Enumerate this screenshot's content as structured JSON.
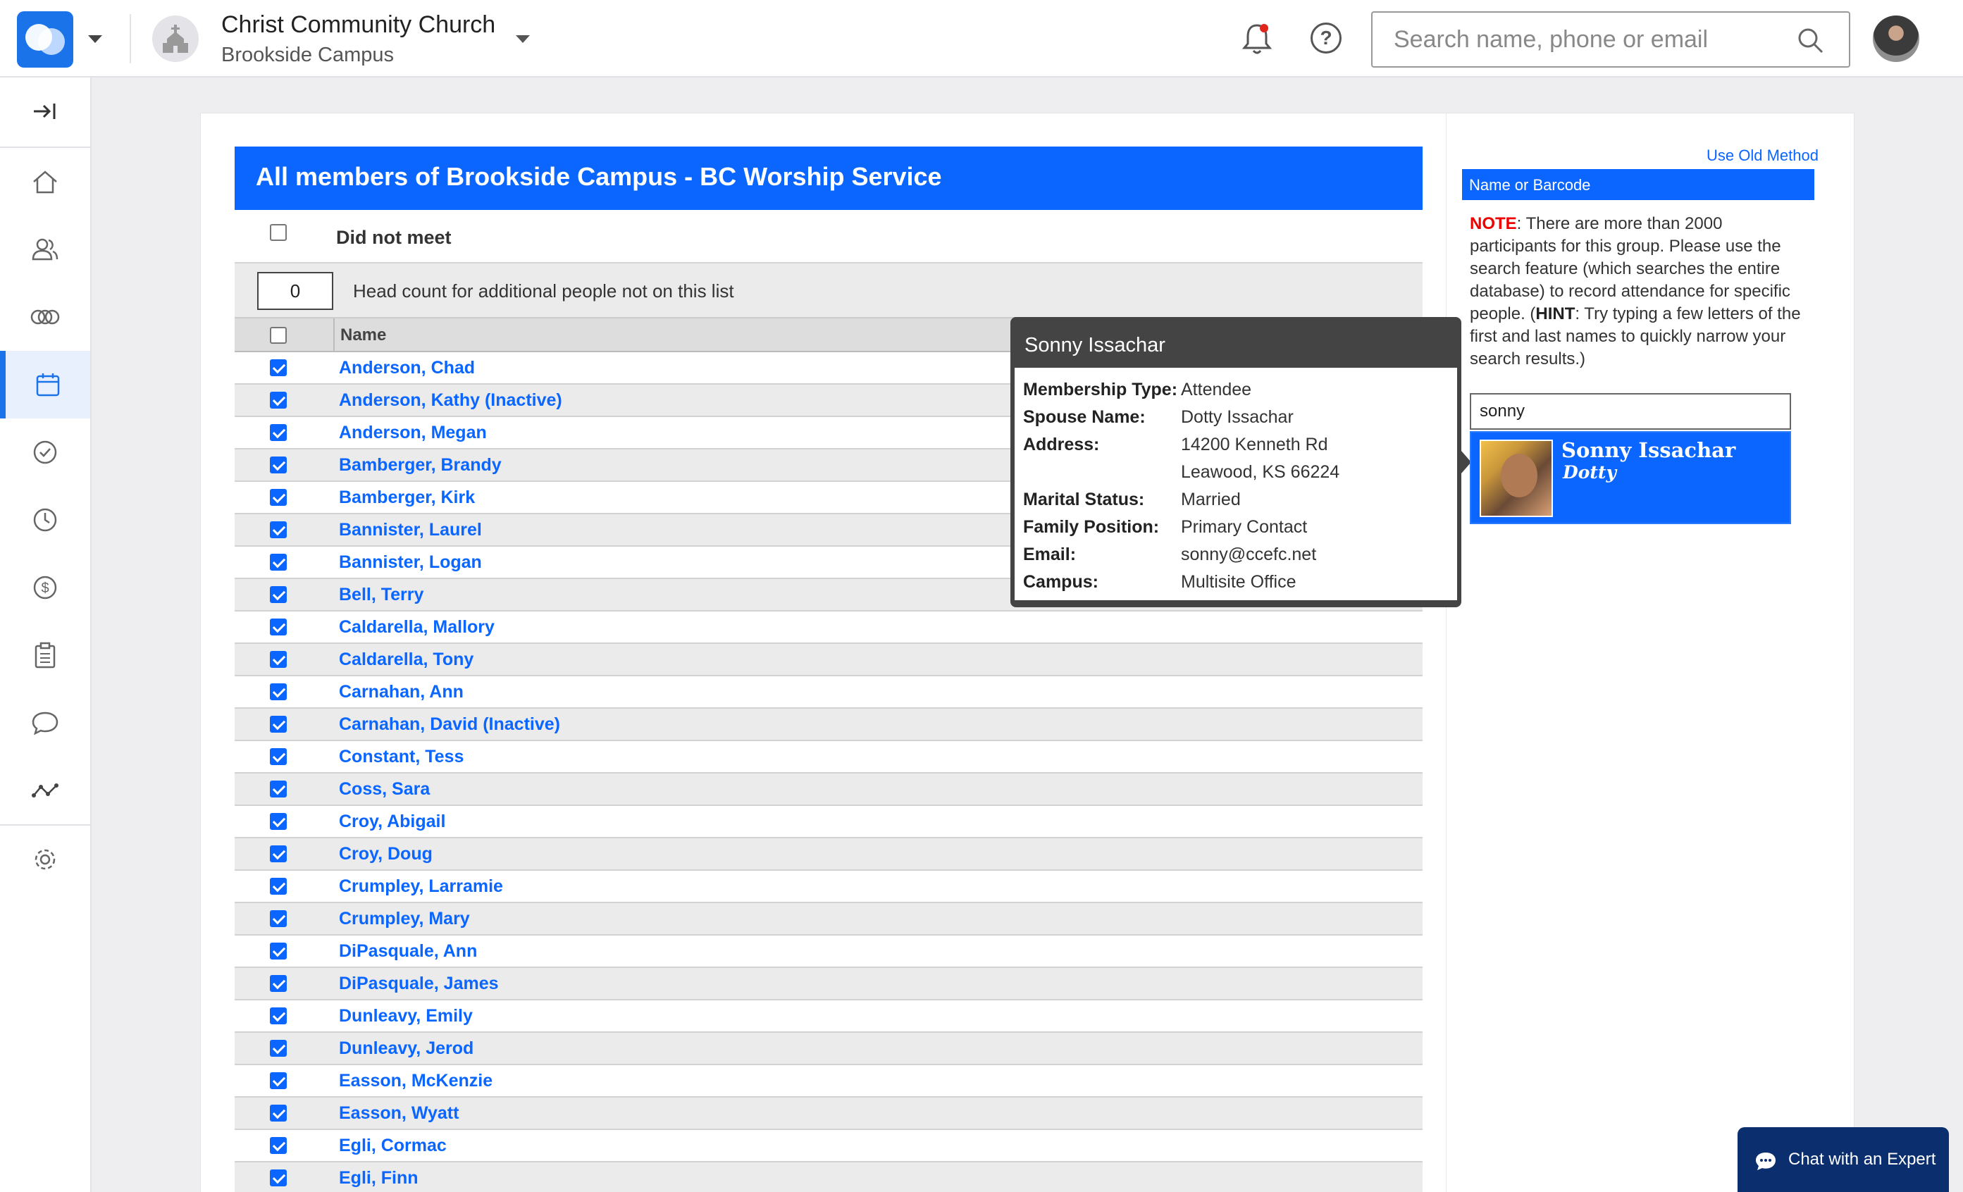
{
  "header": {
    "church_name": "Christ Community Church",
    "campus_name": "Brookside Campus",
    "search_placeholder": "Search name, phone or email"
  },
  "sidebar": {
    "items": [
      {
        "name": "collapse-icon"
      },
      {
        "name": "home-icon"
      },
      {
        "name": "people-icon"
      },
      {
        "name": "groups-icon"
      },
      {
        "name": "calendar-icon",
        "active": true
      },
      {
        "name": "checkmark-icon"
      },
      {
        "name": "clock-icon"
      },
      {
        "name": "dollar-icon"
      },
      {
        "name": "clipboard-icon"
      },
      {
        "name": "chat-icon"
      },
      {
        "name": "analytics-icon"
      },
      {
        "name": "gear-icon"
      }
    ]
  },
  "attendance": {
    "title": "All members of Brookside Campus - BC Worship Service",
    "did_not_meet_label": "Did not meet",
    "head_count_value": "0",
    "head_count_label": "Head count for additional people not on this list",
    "name_column": "Name",
    "rows": [
      {
        "name": "Anderson, Chad"
      },
      {
        "name": "Anderson, Kathy (Inactive)"
      },
      {
        "name": "Anderson, Megan"
      },
      {
        "name": "Bamberger, Brandy"
      },
      {
        "name": "Bamberger, Kirk"
      },
      {
        "name": "Bannister, Laurel"
      },
      {
        "name": "Bannister, Logan"
      },
      {
        "name": "Bell, Terry"
      },
      {
        "name": "Caldarella, Mallory"
      },
      {
        "name": "Caldarella, Tony"
      },
      {
        "name": "Carnahan, Ann"
      },
      {
        "name": "Carnahan, David (Inactive)"
      },
      {
        "name": "Constant, Tess"
      },
      {
        "name": "Coss, Sara"
      },
      {
        "name": "Croy, Abigail"
      },
      {
        "name": "Croy, Doug"
      },
      {
        "name": "Crumpley, Larramie"
      },
      {
        "name": "Crumpley, Mary"
      },
      {
        "name": "DiPasquale, Ann"
      },
      {
        "name": "DiPasquale, James"
      },
      {
        "name": "Dunleavy, Emily"
      },
      {
        "name": "Dunleavy, Jerod"
      },
      {
        "name": "Easson, McKenzie"
      },
      {
        "name": "Easson, Wyatt"
      },
      {
        "name": "Egli, Cormac"
      },
      {
        "name": "Egli, Finn"
      }
    ]
  },
  "popup": {
    "title": "Sonny Issachar",
    "fields": [
      {
        "label": "Membership Type:",
        "value": "Attendee"
      },
      {
        "label": "Spouse Name:",
        "value": "Dotty Issachar"
      },
      {
        "label": "Address:",
        "value": "14200 Kenneth Rd"
      },
      {
        "label": "",
        "value": "Leawood, KS 66224"
      },
      {
        "label": "Marital Status:",
        "value": "Married"
      },
      {
        "label": "Family Position:",
        "value": "Primary Contact"
      },
      {
        "label": "Email:",
        "value": "sonny@ccefc.net"
      },
      {
        "label": "Campus:",
        "value": "Multisite Office"
      }
    ]
  },
  "right_panel": {
    "use_old_method": "Use Old Method",
    "header": "Name or Barcode",
    "note_label": "NOTE",
    "note_text_1": ": There are more than 2000 participants for this group. Please use the search feature (which searches the entire database) to record attendance for specific people. (",
    "hint_label": "HINT",
    "note_text_2": ": Try typing a few letters of the first and last names to quickly narrow your search results.)",
    "search_value": "sonny",
    "result_name": "Sonny Issachar",
    "result_spouse": "Dotty"
  },
  "chat": {
    "label": "Chat with an Expert"
  },
  "colors": {
    "accent": "#0a66ff",
    "popup_bg": "#444444",
    "row_alt": "#ebebeb"
  }
}
